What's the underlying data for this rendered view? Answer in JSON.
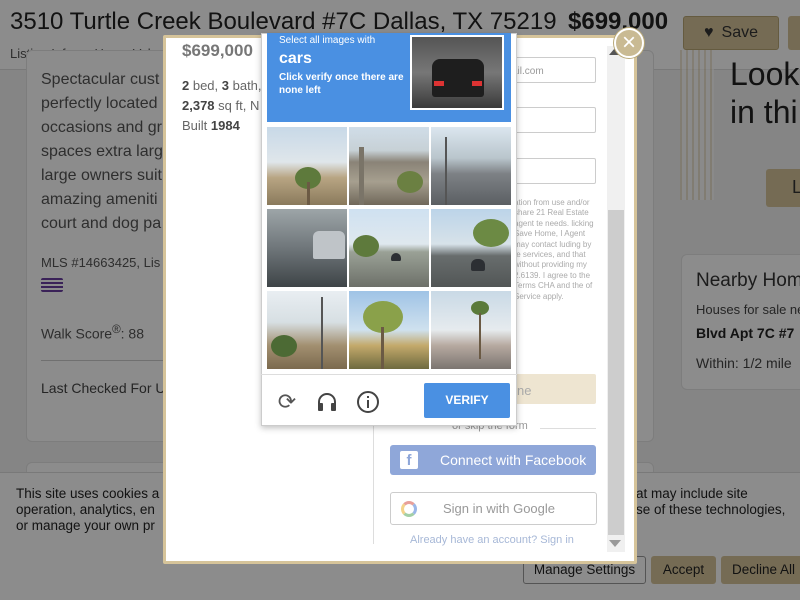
{
  "listing": {
    "address": "3510 Turtle Creek Boulevard #7C Dallas, TX 75219",
    "price": "$699,000",
    "save_label": "Save",
    "subnav": [
      "Listing Info",
      "Home Value I"
    ],
    "description": "Spectacular cust perfectly located occasions and gr spaces extra larg large owners suit amazing ameniti court and dog pa",
    "mls": "MLS #14663425, Lis",
    "walk_score_label": "Walk Score",
    "walk_score_value": ": 88",
    "last_checked": "Last Checked For U"
  },
  "right_column": {
    "headline": "Look in thi",
    "button_fragment": "L",
    "nearby_title": "Nearby Hom",
    "nearby_sub": "Houses for sale ne",
    "nearby_item": "Blvd Apt 7C #7",
    "nearby_within": "Within: 1/2 mile"
  },
  "modal": {
    "price": "$699,000",
    "beds": "2",
    "baths": "3",
    "sqft": "2,378",
    "built": "1984",
    "beds_label": " bed, ",
    "baths_label": " bath, ",
    "sqft_label": " sq ft, N",
    "built_label": "Built ",
    "email_placeholder": "ail.com",
    "legal_text": "ation from use and/or share 21 Real Estate agent te needs. licking Save Home, I Agent may contact luding by te services, and that without providing my 2.6139. I agree to the Terms CHA and the of Service apply.",
    "save_home_fragment": "ne",
    "or_skip": "or skip the form",
    "facebook_label": "Connect with Facebook",
    "google_label": "Sign in with Google",
    "already_label": "Already have an account? Sign in",
    "close_symbol": "×"
  },
  "captcha": {
    "select_text": "Select all images with",
    "target": "cars",
    "hint": "Click verify once there are none left",
    "verify_label": "VERIFY",
    "icons": [
      "reload-icon",
      "headphones-icon",
      "info-icon"
    ]
  },
  "cookie": {
    "text": "This site uses cookies a operation, analytics, en or manage your own pr",
    "text_right": "at may include site se of these technologies,",
    "manage_label": "Manage Settings",
    "accept_label": "Accept",
    "decline_label": "Decline All"
  },
  "colors": {
    "gold": "#d6c49a",
    "captcha_blue": "#4a90e2",
    "facebook_blue": "#8fa7d9"
  }
}
